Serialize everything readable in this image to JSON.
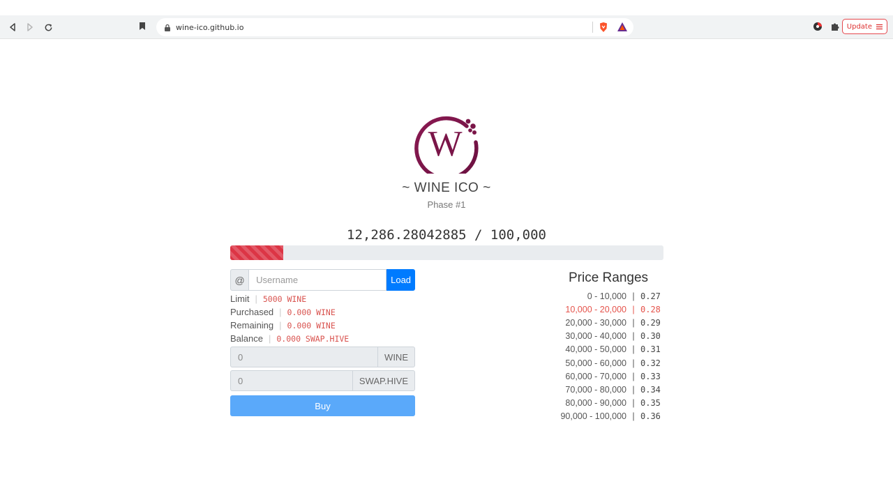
{
  "browser": {
    "url": "wine-ico.github.io",
    "update_label": "Update",
    "update_icon": "menu-icon"
  },
  "header": {
    "logo_letter": "W",
    "title": "~ WINE ICO ~",
    "phase": "Phase #1"
  },
  "progress": {
    "text": "12,286.28042885 / 100,000",
    "sold": 12286.28042885,
    "total": 100000,
    "color": "#dc3545"
  },
  "user_form": {
    "prefix": "@",
    "username_placeholder": "Username",
    "load_label": "Load"
  },
  "info": {
    "limit": {
      "label": "Limit",
      "value": "5000 WINE"
    },
    "purchased": {
      "label": "Purchased",
      "value": "0.000 WINE"
    },
    "remaining": {
      "label": "Remaining",
      "value": "0.000 WINE"
    },
    "balance": {
      "label": "Balance",
      "value": "0.000 SWAP.HIVE"
    }
  },
  "purchase": {
    "wine_amount": "0",
    "wine_unit": "WINE",
    "hive_amount": "0",
    "hive_unit": "SWAP.HIVE",
    "buy_label": "Buy"
  },
  "price_ranges": {
    "title": "Price Ranges",
    "separator": "|",
    "rows": [
      {
        "range": "0 - 10,000",
        "price": "0.27"
      },
      {
        "range": "10,000 - 20,000",
        "price": "0.28",
        "active": true
      },
      {
        "range": "20,000 - 30,000",
        "price": "0.29"
      },
      {
        "range": "30,000 - 40,000",
        "price": "0.30"
      },
      {
        "range": "40,000 - 50,000",
        "price": "0.31"
      },
      {
        "range": "50,000 - 60,000",
        "price": "0.32"
      },
      {
        "range": "60,000 - 70,000",
        "price": "0.33"
      },
      {
        "range": "70,000 - 80,000",
        "price": "0.34"
      },
      {
        "range": "80,000 - 90,000",
        "price": "0.35"
      },
      {
        "range": "90,000 - 100,000",
        "price": "0.36"
      }
    ]
  },
  "colors": {
    "brand": "#7a1548",
    "accent": "#007bff",
    "highlight": "#e5534b"
  }
}
